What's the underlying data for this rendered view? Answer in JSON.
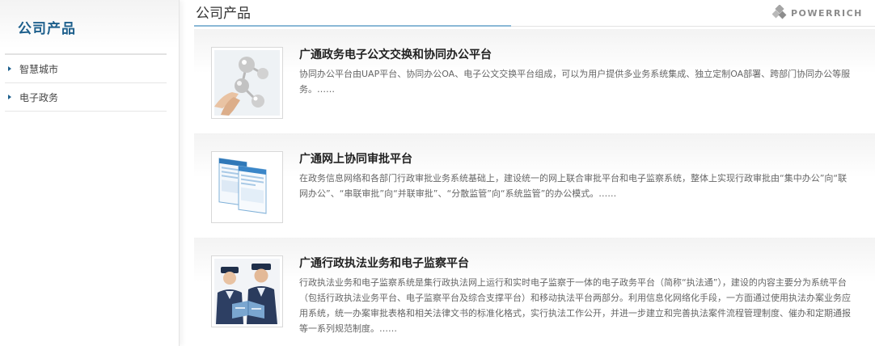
{
  "sidebar": {
    "title": "公司产品",
    "items": [
      {
        "label": "智慧城市"
      },
      {
        "label": "电子政务"
      }
    ]
  },
  "header": {
    "title": "公司产品",
    "brand": "POWERRICH"
  },
  "products": [
    {
      "title": "广通政务电子公文交换和协同办公平台",
      "description": "协同办公平台由UAP平台、协同办公OA、电子公文交换平台组成，可以为用户提供多业务系统集成、独立定制OA部署、跨部门协同办公等服务。……"
    },
    {
      "title": "广通网上协同审批平台",
      "description": "在政务信息网络和各部门行政审批业务系统基础上，建设统一的网上联合审批平台和电子监察系统，整体上实现行政审批由“集中办公”向“联网办公”、“串联审批”向“并联审批”、“分散监管”向“系统监管”的办公模式。……"
    },
    {
      "title": "广通行政执法业务和电子监察平台",
      "description": "行政执法业务和电子监察系统是集行政执法网上运行和实时电子监察于一体的电子政务平台（简称“执法通”），建设的内容主要分为系统平台（包括行政执法业务平台、电子监察平台及综合支撑平台）和移动执法平台两部分。利用信息化网络化手段，一方面通过使用执法办案业务应用系统，统一办案审批表格和相关法律文书的标准化格式，实行执法工作公开，并进一步建立和完善执法案件流程管理制度、催办和定期通报等一系列规范制度。……"
    }
  ],
  "colors": {
    "accent": "#1d5f8c",
    "underline": "#8ab8d6",
    "brand_gray": "#8c8c8c"
  },
  "icons": {
    "sidebar_bullet": "triangle-right-icon",
    "brand_logo": "powerrich-logo-icon"
  }
}
